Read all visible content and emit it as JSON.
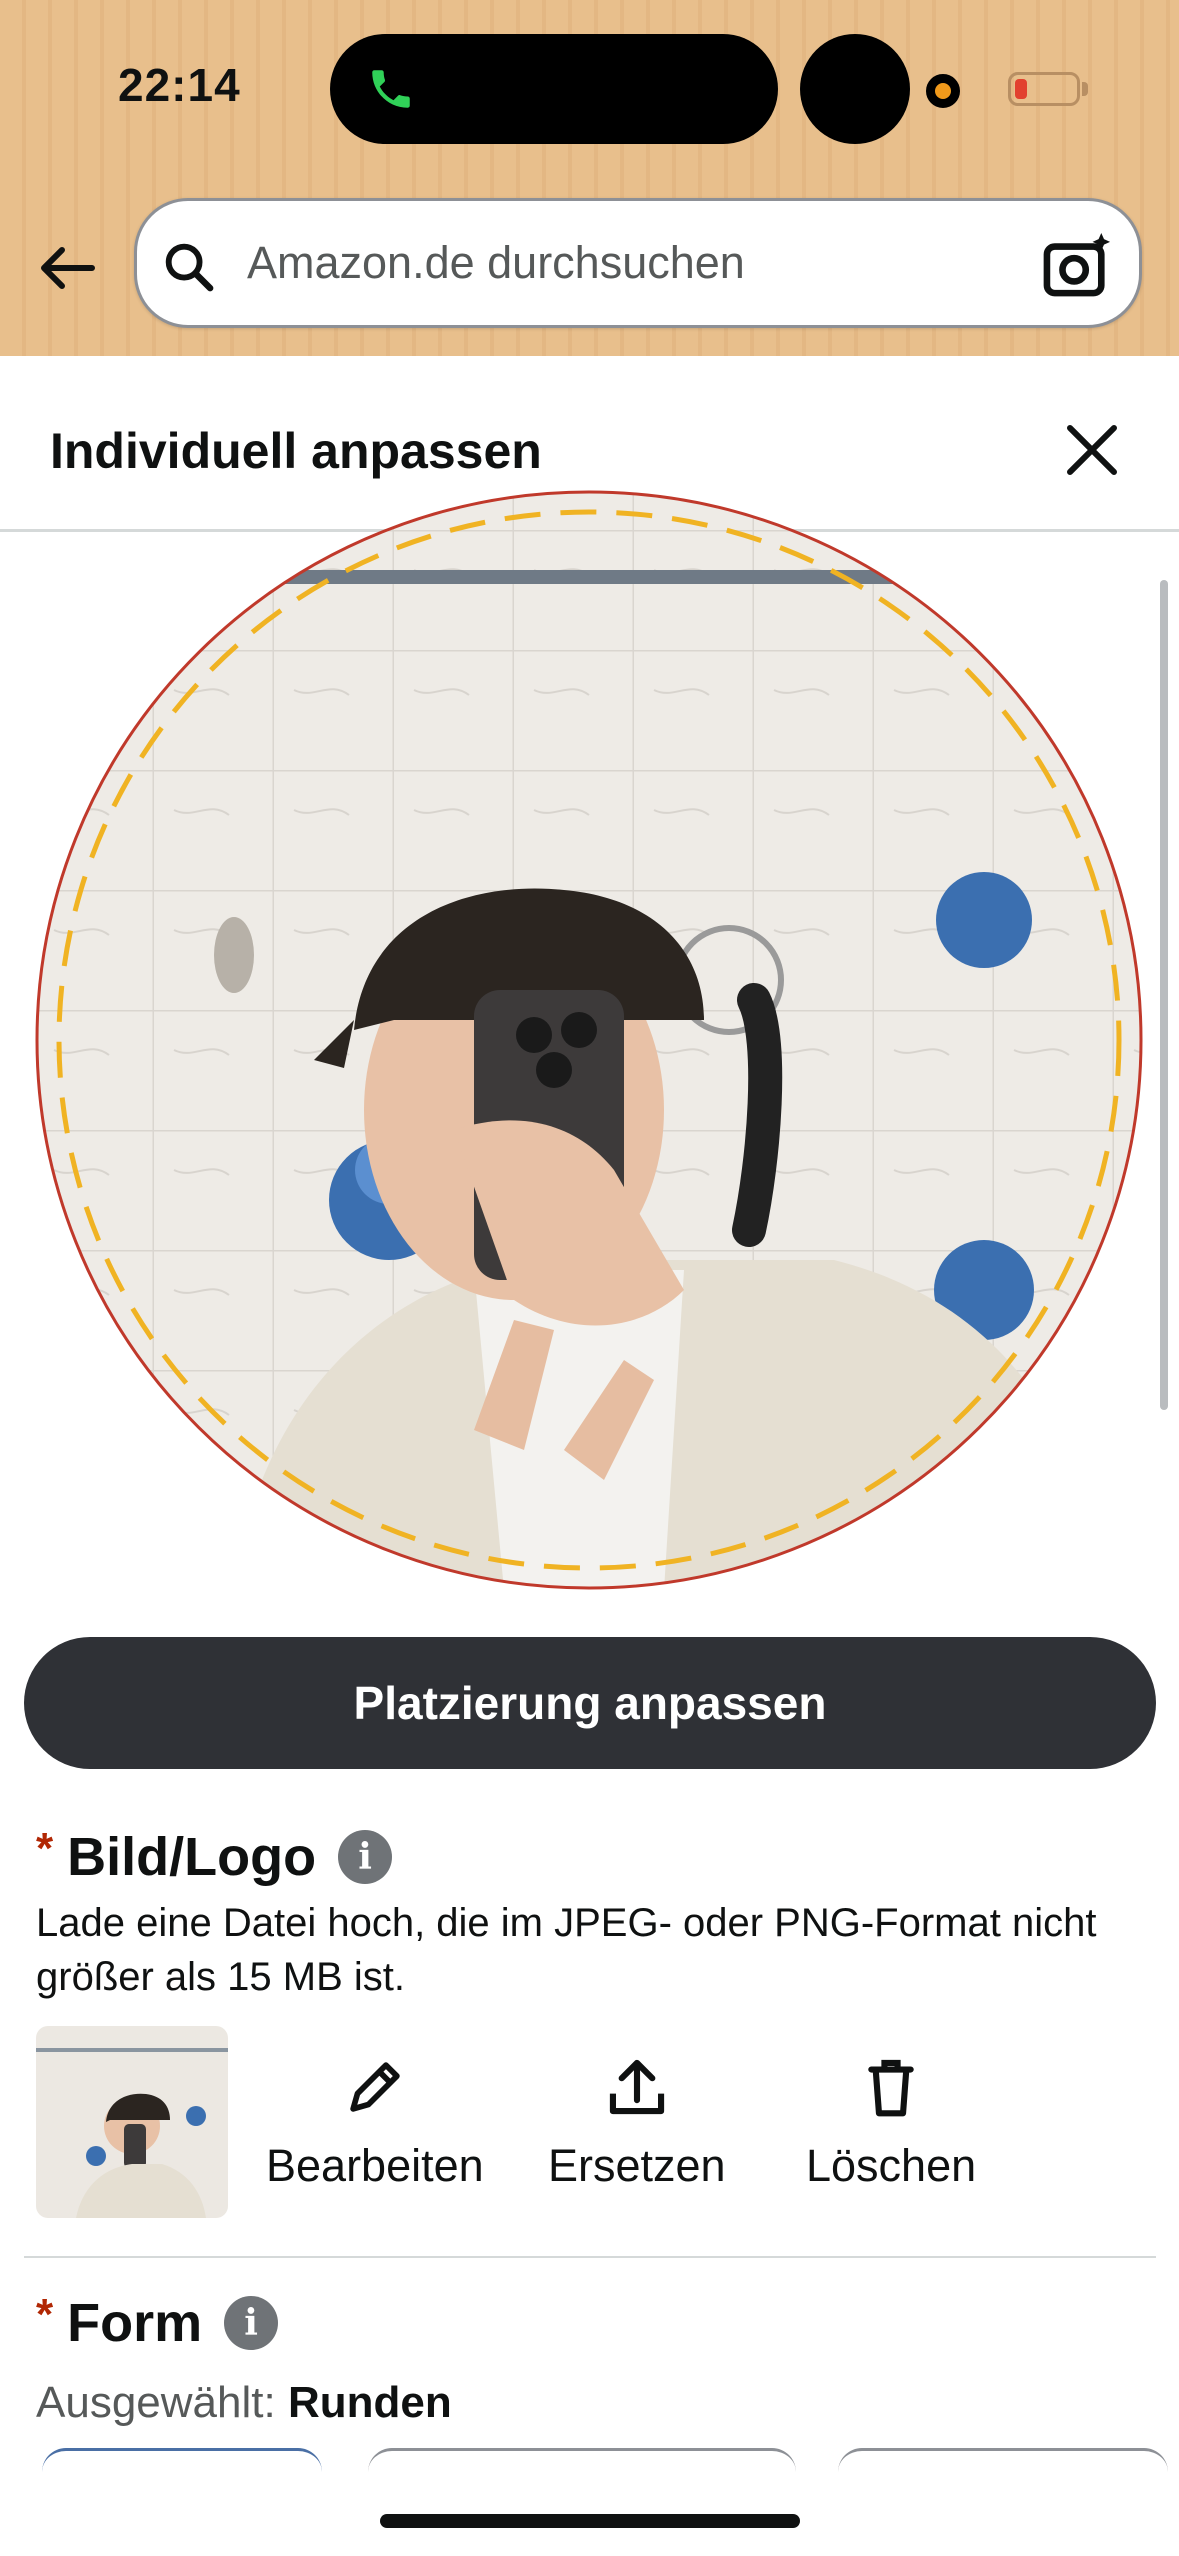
{
  "status_bar": {
    "time": "22:14",
    "call_icon": "phone-icon",
    "battery_color": "#e2412f"
  },
  "search": {
    "placeholder": "Amazon.de durchsuchen",
    "back_icon": "arrow-left-icon",
    "search_icon": "magnifier-icon",
    "camera_icon": "camera-sparkle-icon"
  },
  "sheet": {
    "title": "Individuell anpassen",
    "close_icon": "close-icon"
  },
  "preview": {
    "image": "uploaded-photo-round-crop",
    "guide_color": "#f0b323",
    "border_color": "#c0392b"
  },
  "place_button": {
    "label": "Platzierung anpassen"
  },
  "image_section": {
    "star": "*",
    "title": "Bild/Logo",
    "info": "i",
    "description": "Lade eine Datei hoch, die im JPEG- oder PNG-Format nicht größer als 15 MB ist.",
    "actions": [
      {
        "label": "Bearbeiten",
        "icon": "pencil-icon"
      },
      {
        "label": "Ersetzen",
        "icon": "upload-icon"
      },
      {
        "label": "Löschen",
        "icon": "trash-icon"
      }
    ]
  },
  "shape_section": {
    "star": "*",
    "title": "Form",
    "info": "i",
    "selected_label": "Ausgewählt:",
    "selected_value": "Runden"
  },
  "colors": {
    "header_bg": "#e8bf8c",
    "button_dark": "#2f3136",
    "required": "#b12704"
  }
}
